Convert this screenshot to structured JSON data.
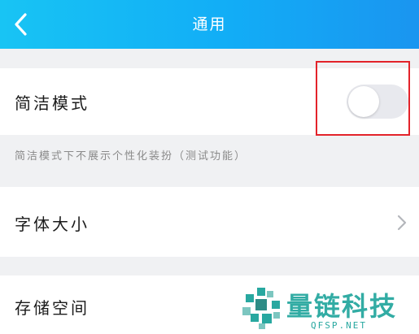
{
  "header": {
    "title": "通用",
    "back_icon": "chevron-left-icon"
  },
  "settings": {
    "simple_mode": {
      "label": "简洁模式",
      "toggle_on": false,
      "description": "简洁模式下不展示个性化装扮（测试功能）"
    },
    "font_size": {
      "label": "字体大小",
      "icon": "chevron-right-icon"
    },
    "storage": {
      "label": "存储空间"
    }
  },
  "watermark": {
    "brand": "量链科技",
    "domain": "QFSP.NET"
  },
  "colors": {
    "header_start": "#18c4f4",
    "header_end": "#1a95f0",
    "highlight": "#e3232a",
    "watermark": "#28a8a0"
  }
}
